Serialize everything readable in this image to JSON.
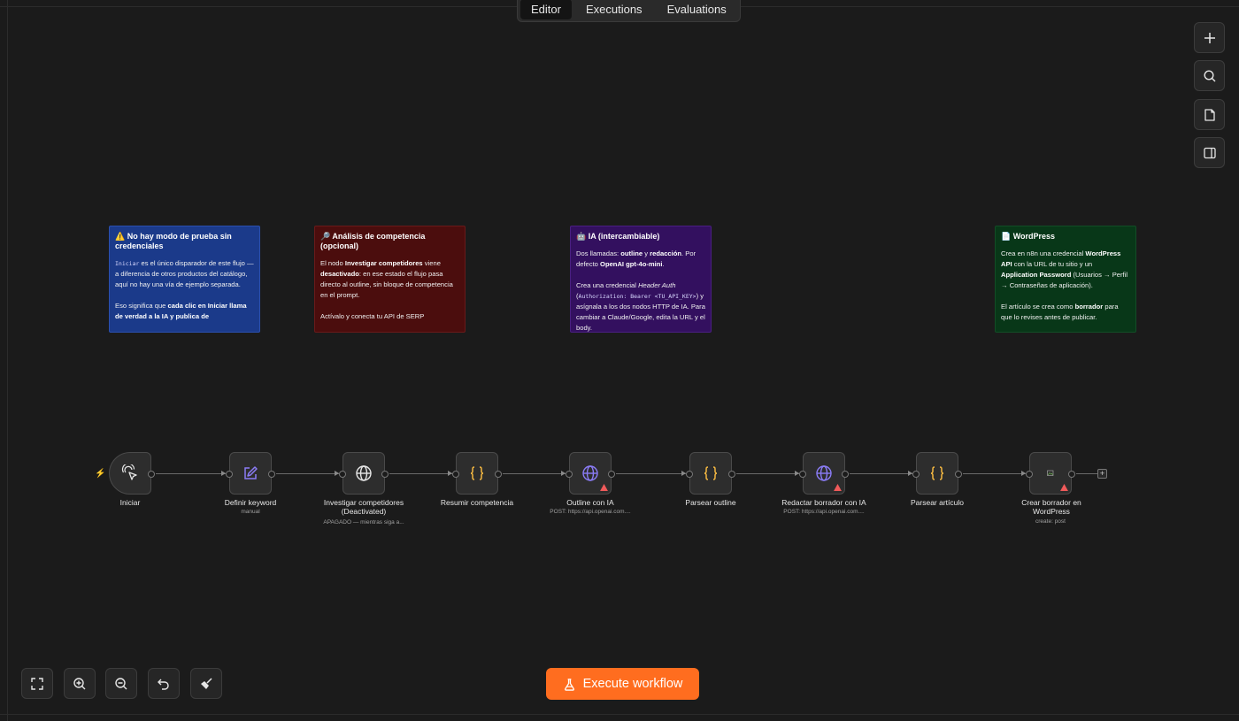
{
  "tabs": [
    {
      "label": "Editor"
    },
    {
      "label": "Executions"
    },
    {
      "label": "Evaluations"
    }
  ],
  "toolbar": {
    "add_icon": "plus-icon",
    "search_icon": "search-icon",
    "sticky_icon": "sticky-note-icon",
    "panel_icon": "side-panel-icon"
  },
  "stickies": {
    "no_test": {
      "title": "⚠️ No hay modo de prueba sin credenciales",
      "code": "Iniciar",
      "p1_rest": " es el único disparador de este flujo — a diferencia de otros productos del catálogo, aquí no hay una vía de ejemplo separada.",
      "p2_a": "Eso significa que ",
      "p2_b": "cada clic en Iniciar llama de verdad a la IA y publica de"
    },
    "competencia": {
      "title": "🔎 Análisis de competencia (opcional)",
      "p1_a": "El nodo ",
      "p1_b": "Investigar competidores",
      "p1_c": " viene ",
      "p1_d": "desactivado",
      "p1_e": ": en ese estado el flujo pasa directo al outline, sin bloque de competencia en el prompt.",
      "p2": "Actívalo y conecta tu API de SERP"
    },
    "ia": {
      "title": "🤖 IA (intercambiable)",
      "p1_a": "Dos llamadas: ",
      "p1_b": "outline",
      "p1_c": " y ",
      "p1_d": "redacción",
      "p1_e": ". Por defecto ",
      "p1_f": "OpenAI gpt-4o-mini",
      "p1_g": ".",
      "p2_a": "Crea una credencial ",
      "p2_b": "Header Auth",
      "p2_c": " (",
      "p2_code": "Authorization: Bearer <TU_API_KEY>",
      "p2_d": ") y asígnala a los dos nodos HTTP de IA. Para cambiar a Claude/Google, edita la URL y el body."
    },
    "wordpress": {
      "title": "📄 WordPress",
      "p1_a": "Crea en n8n una credencial ",
      "p1_b": "WordPress API",
      "p1_c": " con la URL de tu sitio y un ",
      "p1_d": "Application Password",
      "p1_e": " (Usuarios → Perfil → Contraseñas de aplicación).",
      "p2_a": "El artículo se crea como ",
      "p2_b": "borrador",
      "p2_c": " para que lo revises antes de publicar."
    }
  },
  "nodes": [
    {
      "label": "Iniciar",
      "sub": "",
      "icon": "cursor-click-icon"
    },
    {
      "label": "Definir keyword",
      "sub": "manual",
      "icon": "edit-icon"
    },
    {
      "label": "Investigar competidores (Deactivated)",
      "sub": "APAGADO — mientras siga a...",
      "icon": "globe-icon"
    },
    {
      "label": "Resumir competencia",
      "sub": "",
      "icon": "code-braces-icon"
    },
    {
      "label": "Outline con IA",
      "sub": "POST: https://api.openai.com....",
      "icon": "globe-icon"
    },
    {
      "label": "Parsear outline",
      "sub": "",
      "icon": "code-braces-icon"
    },
    {
      "label": "Redactar borrador con IA",
      "sub": "POST: https://api.openai.com....",
      "icon": "globe-icon"
    },
    {
      "label": "Parsear artículo",
      "sub": "",
      "icon": "code-braces-icon"
    },
    {
      "label": "Crear borrador en WordPress",
      "sub": "create: post",
      "icon": "broken-image-icon"
    }
  ],
  "controls": {
    "fit_icon": "fit-view-icon",
    "zoom_in_icon": "zoom-in-icon",
    "zoom_out_icon": "zoom-out-icon",
    "undo_icon": "undo-icon",
    "tidy_icon": "broom-icon"
  },
  "execute": {
    "label": "Execute workflow",
    "icon": "flask-icon"
  },
  "colors": {
    "accent": "#ff6d1f",
    "warning": "#f05a5a",
    "brace": "#f5b841",
    "edit": "#8b7cf6"
  }
}
